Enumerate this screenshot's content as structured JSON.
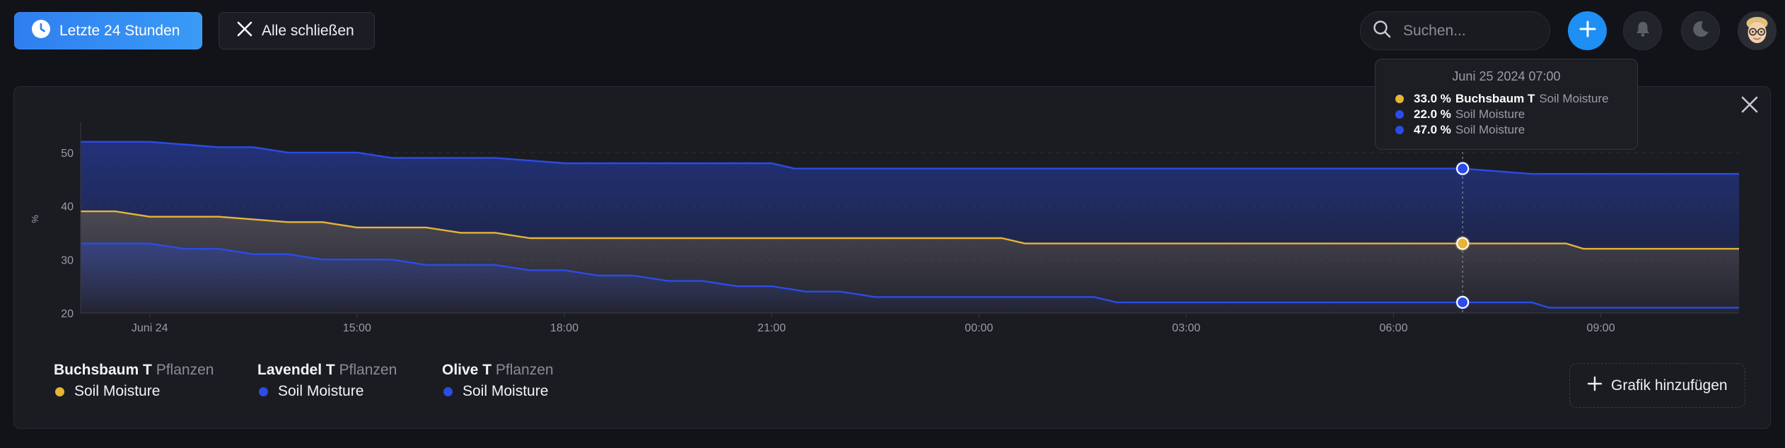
{
  "toolbar": {
    "time_range_label": "Letzte 24 Stunden",
    "close_all_label": "Alle schließen",
    "search_placeholder": "Suchen..."
  },
  "icons": {
    "time_range": "clock-icon",
    "close_all": "close-icon",
    "search": "search-icon",
    "add": "plus-icon",
    "notifications": "bell-icon",
    "theme": "moon-icon",
    "user": "avatar",
    "close_panel": "close-icon",
    "add_chart": "plus-icon"
  },
  "colors": {
    "primary": "#2f86f2",
    "series_yellow": "#e6b535",
    "series_blue": "#2b4ce6"
  },
  "tooltip": {
    "title": "Juni 25 2024 07:00",
    "rows": [
      {
        "value": "33.0 %",
        "device": "Buchsbaum T",
        "metric": "Soil Moisture",
        "color": "#e6b535"
      },
      {
        "value": "22.0 %",
        "device": "",
        "metric": "Soil Moisture",
        "color": "#2b4ce6"
      },
      {
        "value": "47.0 %",
        "device": "",
        "metric": "Soil Moisture",
        "color": "#2b4ce6"
      }
    ]
  },
  "legend": [
    {
      "device": "Buchsbaum T",
      "group": "Pflanzen",
      "metric": "Soil Moisture",
      "color": "#e6b535"
    },
    {
      "device": "Lavendel T",
      "group": "Pflanzen",
      "metric": "Soil Moisture",
      "color": "#2b4ce6"
    },
    {
      "device": "Olive T",
      "group": "Pflanzen",
      "metric": "Soil Moisture",
      "color": "#2b4ce6"
    }
  ],
  "add_chart_label": "Grafik hinzufügen",
  "chart_data": {
    "type": "area",
    "ylabel": "%",
    "ylim": [
      20,
      55
    ],
    "xlim": [
      "2024-06-24 11:00",
      "2024-06-25 11:00"
    ],
    "yticks": [
      "20",
      "30",
      "40",
      "50"
    ],
    "xticks": [
      {
        "t": "2024-06-24 12:00",
        "label": "Juni 24"
      },
      {
        "t": "2024-06-24 15:00",
        "label": "15:00"
      },
      {
        "t": "2024-06-24 18:00",
        "label": "18:00"
      },
      {
        "t": "2024-06-24 21:00",
        "label": "21:00"
      },
      {
        "t": "2024-06-25 00:00",
        "label": "00:00"
      },
      {
        "t": "2024-06-25 03:00",
        "label": "03:00"
      },
      {
        "t": "2024-06-25 06:00",
        "label": "06:00"
      },
      {
        "t": "2024-06-25 09:00",
        "label": "09:00"
      }
    ],
    "hover_time": "2024-06-25 07:00",
    "series": [
      {
        "color": "#2b4ce6",
        "points": [
          [
            "2024-06-24 11:00",
            52
          ],
          [
            "2024-06-24 12:00",
            52
          ],
          [
            "2024-06-24 13:00",
            51
          ],
          [
            "2024-06-24 13:30",
            51
          ],
          [
            "2024-06-24 14:00",
            50
          ],
          [
            "2024-06-24 15:00",
            50
          ],
          [
            "2024-06-24 15:30",
            49
          ],
          [
            "2024-06-24 17:00",
            49
          ],
          [
            "2024-06-24 18:00",
            48
          ],
          [
            "2024-06-24 21:00",
            48
          ],
          [
            "2024-06-24 21:20",
            47
          ],
          [
            "2024-06-25 07:00",
            47
          ],
          [
            "2024-06-25 08:00",
            46
          ],
          [
            "2024-06-25 11:00",
            46
          ]
        ]
      },
      {
        "color": "#e6b535",
        "points": [
          [
            "2024-06-24 11:00",
            39
          ],
          [
            "2024-06-24 11:30",
            39
          ],
          [
            "2024-06-24 12:00",
            38
          ],
          [
            "2024-06-24 13:00",
            38
          ],
          [
            "2024-06-24 14:00",
            37
          ],
          [
            "2024-06-24 14:30",
            37
          ],
          [
            "2024-06-24 15:00",
            36
          ],
          [
            "2024-06-24 16:00",
            36
          ],
          [
            "2024-06-24 16:30",
            35
          ],
          [
            "2024-06-24 17:00",
            35
          ],
          [
            "2024-06-24 17:30",
            34
          ],
          [
            "2024-06-25 00:20",
            34
          ],
          [
            "2024-06-25 00:40",
            33
          ],
          [
            "2024-06-25 08:30",
            33
          ],
          [
            "2024-06-25 08:45",
            32
          ],
          [
            "2024-06-25 11:00",
            32
          ]
        ]
      },
      {
        "color": "#2b4ce6",
        "points": [
          [
            "2024-06-24 11:00",
            33
          ],
          [
            "2024-06-24 12:00",
            33
          ],
          [
            "2024-06-24 12:30",
            32
          ],
          [
            "2024-06-24 13:00",
            32
          ],
          [
            "2024-06-24 13:30",
            31
          ],
          [
            "2024-06-24 14:00",
            31
          ],
          [
            "2024-06-24 14:30",
            30
          ],
          [
            "2024-06-24 15:30",
            30
          ],
          [
            "2024-06-24 16:00",
            29
          ],
          [
            "2024-06-24 17:00",
            29
          ],
          [
            "2024-06-24 17:30",
            28
          ],
          [
            "2024-06-24 18:00",
            28
          ],
          [
            "2024-06-24 18:30",
            27
          ],
          [
            "2024-06-24 19:00",
            27
          ],
          [
            "2024-06-24 19:30",
            26
          ],
          [
            "2024-06-24 20:00",
            26
          ],
          [
            "2024-06-24 20:30",
            25
          ],
          [
            "2024-06-24 21:00",
            25
          ],
          [
            "2024-06-24 21:30",
            24
          ],
          [
            "2024-06-24 22:00",
            24
          ],
          [
            "2024-06-24 22:30",
            23
          ],
          [
            "2024-06-25 01:40",
            23
          ],
          [
            "2024-06-25 02:00",
            22
          ],
          [
            "2024-06-25 08:00",
            22
          ],
          [
            "2024-06-25 08:15",
            21
          ],
          [
            "2024-06-25 11:00",
            21
          ]
        ]
      }
    ]
  }
}
